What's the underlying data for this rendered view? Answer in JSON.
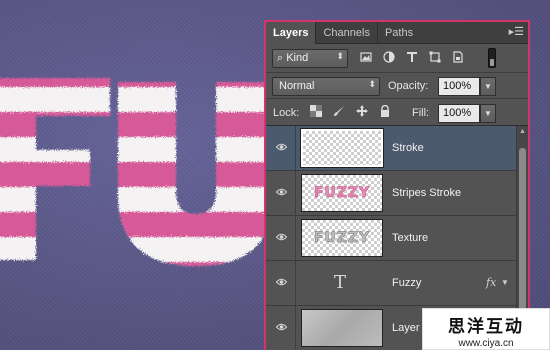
{
  "canvas": {
    "artwork_text": "FUZZY",
    "background_color": "#5a5884",
    "stripe_pink": "#d55a97",
    "stripe_white": "#f4f2f3"
  },
  "panel": {
    "accent_border": "#d6336c",
    "tabs": [
      {
        "label": "Layers",
        "active": true
      },
      {
        "label": "Channels",
        "active": false
      },
      {
        "label": "Paths",
        "active": false
      }
    ],
    "menu_icon": "panel-menu-icon",
    "filter": {
      "kind_label": "Kind",
      "search_icon": "search-icon",
      "icons": [
        "pixel-layer-filter-icon",
        "adjustment-layer-filter-icon",
        "type-layer-filter-icon",
        "shape-layer-filter-icon",
        "smart-object-filter-icon"
      ]
    },
    "blend": {
      "mode": "Normal",
      "opacity_label": "Opacity:",
      "opacity_value": "100%"
    },
    "lock": {
      "label": "Lock:",
      "icons": [
        "lock-transparent-icon",
        "lock-image-icon",
        "lock-position-icon",
        "lock-all-icon"
      ],
      "fill_label": "Fill:",
      "fill_value": "100%"
    },
    "layers": [
      {
        "name": "Stroke",
        "selected": true,
        "thumb": "transparent",
        "thumb_text": ""
      },
      {
        "name": "Stripes Stroke",
        "selected": false,
        "thumb": "pink-text",
        "thumb_text": "FUZZY"
      },
      {
        "name": "Texture",
        "selected": false,
        "thumb": "gray-text",
        "thumb_text": "FUZZY"
      },
      {
        "name": "Fuzzy",
        "selected": false,
        "thumb": "type",
        "thumb_text": "T",
        "fx": "fx"
      },
      {
        "name": "Layer",
        "selected": false,
        "thumb": "texture",
        "thumb_text": ""
      }
    ]
  },
  "watermark": {
    "chinese": "思洋互动",
    "url": "www.ciya.cn"
  }
}
